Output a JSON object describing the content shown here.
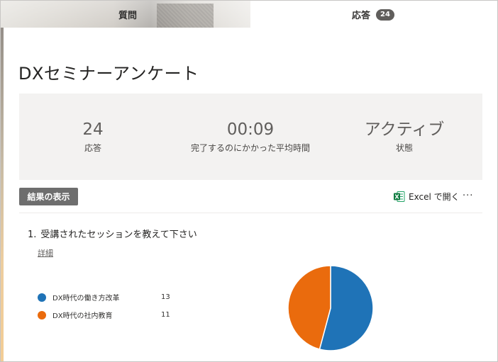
{
  "tabs": {
    "questions_label": "質問",
    "responses_label": "応答",
    "responses_count": "24"
  },
  "form": {
    "title": "DXセミナーアンケート"
  },
  "stats": [
    {
      "value": "24",
      "label": "応答"
    },
    {
      "value": "00:09",
      "label": "完了するのにかかった平均時間"
    },
    {
      "value": "アクティブ",
      "label": "状態"
    }
  ],
  "toolbar": {
    "results_label": "結果の表示",
    "excel_label": "Excel で開く",
    "more_label": "···"
  },
  "question": {
    "number": "1.",
    "text": "受講されたセッションを教えて下さい",
    "details_label": "詳細",
    "options": [
      {
        "label": "DX時代の働き方改革",
        "count": "13",
        "color": "#1f73b7"
      },
      {
        "label": "DX時代の社内教育",
        "count": "11",
        "color": "#ea6b0d"
      }
    ]
  },
  "chart_data": {
    "type": "pie",
    "categories": [
      "DX時代の働き方改革",
      "DX時代の社内教育"
    ],
    "values": [
      13,
      11
    ],
    "colors": [
      "#1f73b7",
      "#ea6b0d"
    ]
  }
}
